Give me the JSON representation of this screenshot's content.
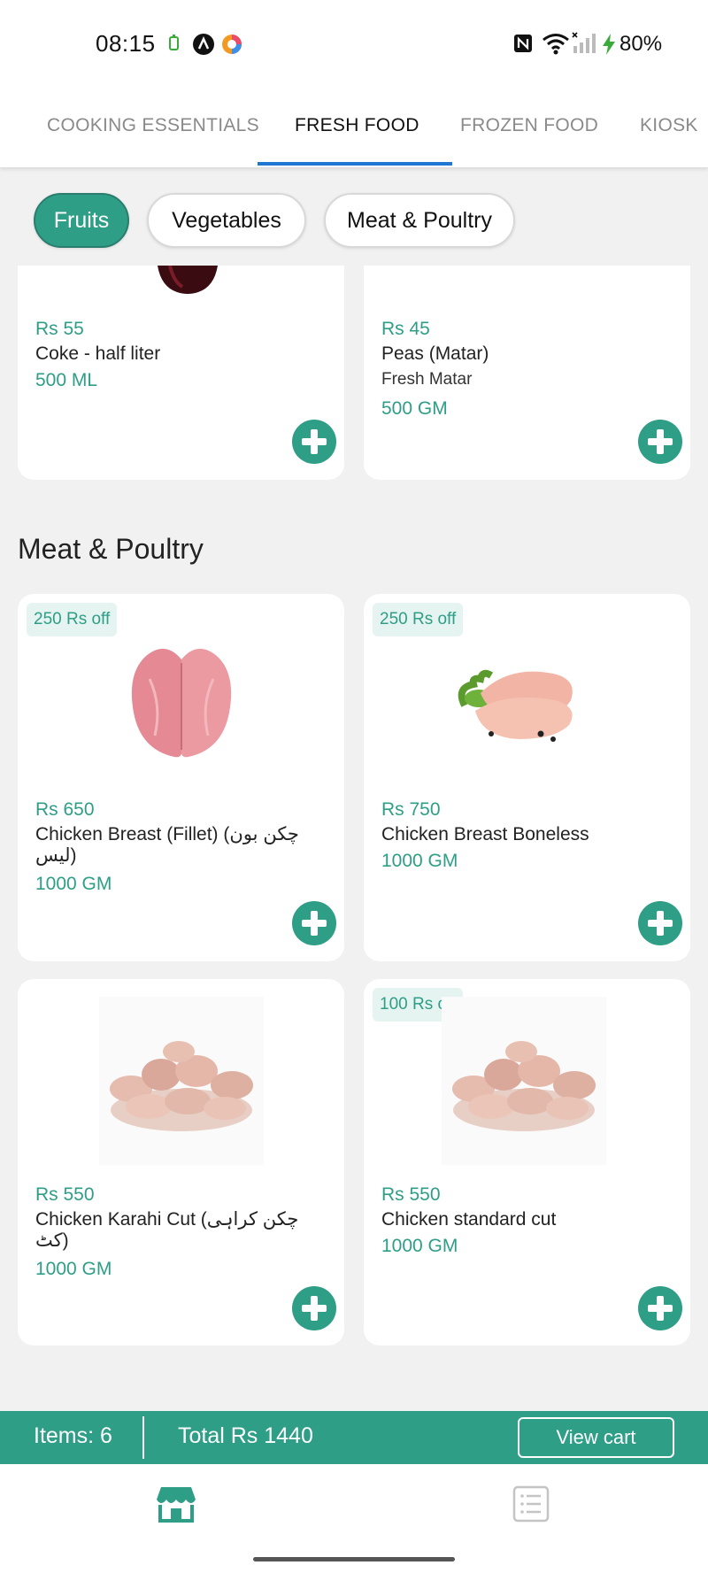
{
  "status_bar": {
    "time": "08:15",
    "battery": "80%"
  },
  "tabs": [
    {
      "label": "COOKING ESSENTIALS"
    },
    {
      "label": "FRESH FOOD"
    },
    {
      "label": "FROZEN FOOD"
    },
    {
      "label": "KIOSK"
    }
  ],
  "chips": [
    {
      "label": "Fruits"
    },
    {
      "label": "Vegetables"
    },
    {
      "label": "Meat & Poultry"
    }
  ],
  "top_products": [
    {
      "price": "Rs 55",
      "name": "Coke - half liter",
      "desc": "",
      "qty": "500 ML"
    },
    {
      "price": "Rs 45",
      "name": "Peas (Matar)",
      "desc": "Fresh Matar",
      "qty": "500 GM"
    }
  ],
  "section_title": "Meat & Poultry",
  "meat_products": [
    {
      "badge": "250 Rs off",
      "price": "Rs 650",
      "name": "Chicken Breast  (Fillet) (چکن بون لیس)",
      "qty": "1000 GM"
    },
    {
      "badge": "250 Rs off",
      "price": "Rs 750",
      "name": "Chicken Breast Boneless",
      "qty": "1000 GM"
    },
    {
      "badge": "",
      "price": "Rs 550",
      "name": "Chicken Karahi Cut (چکن کراہی کٹ)",
      "qty": "1000 GM"
    },
    {
      "badge": "100 Rs off",
      "price": "Rs 550",
      "name": "Chicken standard cut",
      "qty": "1000 GM"
    }
  ],
  "cart": {
    "items": "Items: 6",
    "total": "Total Rs 1440",
    "button": "View cart"
  },
  "bottom_nav": {
    "active_icon": "store-icon",
    "inactive_icon": "orders-list-icon"
  },
  "colors": {
    "accent": "#2e9e87",
    "tab_underline": "#1f77d4"
  }
}
